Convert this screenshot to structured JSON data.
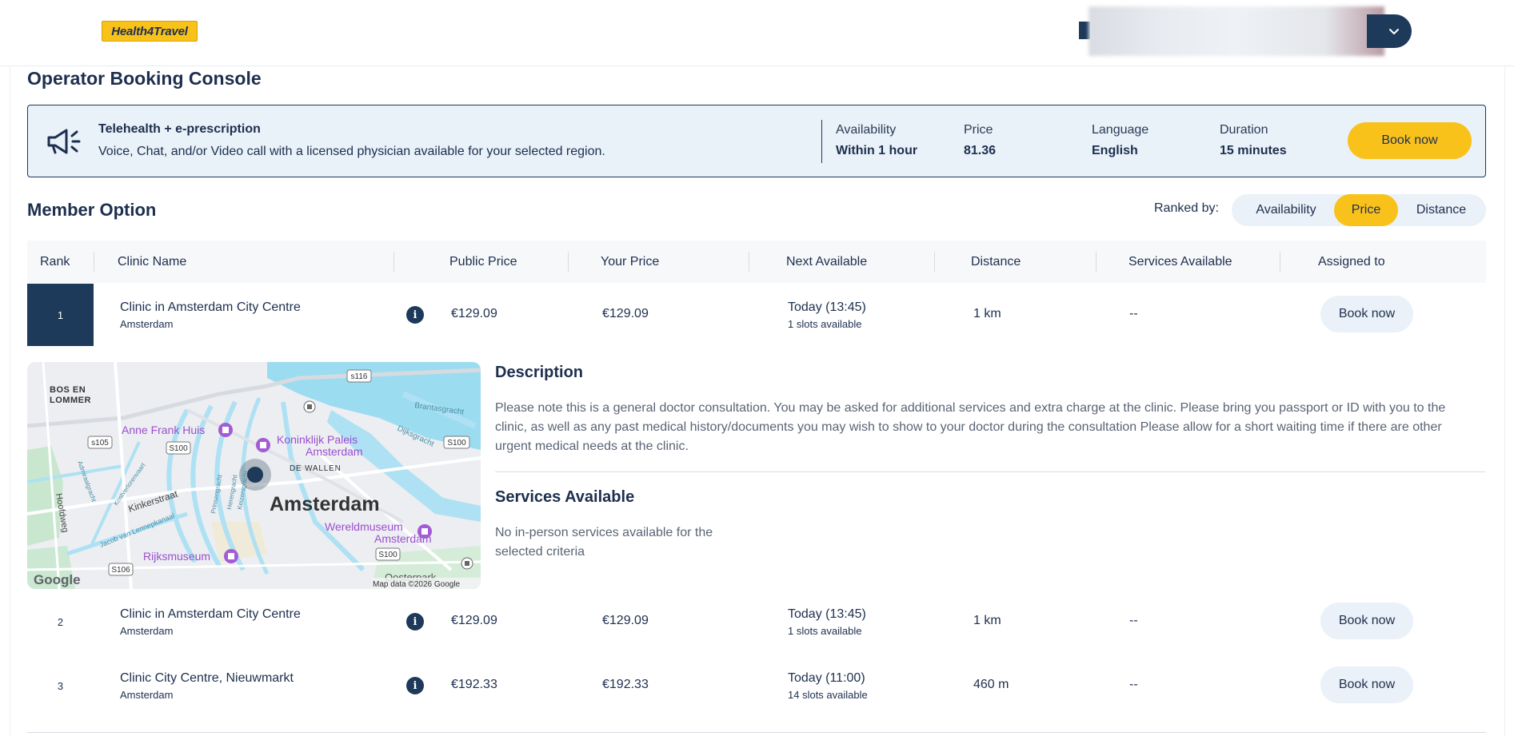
{
  "header": {
    "logo_text": "Health4Travel"
  },
  "page_title": "Operator Booking Console",
  "banner": {
    "title": "Telehealth + e-prescription",
    "description": "Voice, Chat, and/or Video call with a licensed physician available for your selected region.",
    "stats": [
      {
        "label": "Availability",
        "value": "Within 1 hour"
      },
      {
        "label": "Price",
        "value": "81.36"
      },
      {
        "label": "Language",
        "value": "English"
      },
      {
        "label": "Duration",
        "value": "15 minutes"
      }
    ],
    "book_label": "Book now"
  },
  "member_option": {
    "title": "Member Option",
    "ranked_by_label": "Ranked by:",
    "ranking_options": [
      "Availability",
      "Price",
      "Distance"
    ],
    "ranking_selected": "Price"
  },
  "table": {
    "columns": [
      "Rank",
      "Clinic Name",
      "Public Price",
      "Your Price",
      "Next Available",
      "Distance",
      "Services Available",
      "Assigned to"
    ],
    "rows": [
      {
        "rank": "1",
        "name": "Clinic in Amsterdam City Centre",
        "city": "Amsterdam",
        "public_price": "€129.09",
        "your_price": "€129.09",
        "next_available": "Today (13:45)",
        "slots": "1 slots available",
        "distance": "1 km",
        "services": "--",
        "action": "Book now"
      },
      {
        "rank": "2",
        "name": "Clinic in Amsterdam City Centre",
        "city": "Amsterdam",
        "public_price": "€129.09",
        "your_price": "€129.09",
        "next_available": "Today (13:45)",
        "slots": "1 slots available",
        "distance": "1 km",
        "services": "--",
        "action": "Book now"
      },
      {
        "rank": "3",
        "name": "Clinic City Centre, Nieuwmarkt",
        "city": "Amsterdam",
        "public_price": "€192.33",
        "your_price": "€192.33",
        "next_available": "Today (11:00)",
        "slots": "14 slots available",
        "distance": "460 m",
        "services": "--",
        "action": "Book now"
      }
    ]
  },
  "details": {
    "description_title": "Description",
    "description_text": "Please note this is a general doctor consultation. You may be asked for additional services and extra charge at the clinic. Please bring you passport or ID with you to the clinic, as well as any past medical history/documents you may wish to show to your doctor during the consultation Please allow for a short waiting time if there are other urgent medical needs at the clinic.",
    "services_title": "Services Available",
    "services_text": "No in-person services available for the selected criteria"
  },
  "map": {
    "city_label": "Amsterdam",
    "district_label": "BOS EN LOMMER",
    "de_wallen": "DE WALLEN",
    "poi": [
      "Anne Frank Huis",
      "Koninklijk Paleis Amsterdam",
      "Wereldmuseum Amsterdam",
      "Rijksmuseum",
      "Oosterpark"
    ],
    "road_badges": [
      "s116",
      "s105",
      "S100",
      "S100",
      "S100",
      "S106"
    ],
    "streets": [
      "Kinkerstraat",
      "Hoofdweg",
      "Jacob van Lennepkanaal",
      "Brantasgracht",
      "Dijksgracht",
      "Admiraalgracht",
      "Prinsengracht",
      "Herengracht",
      "Keizersgracht",
      "Kostverlorenvaart"
    ],
    "google_label": "Google",
    "attribution": "Map data ©2026 Google"
  },
  "colors": {
    "navy": "#1d3a5a",
    "accent_yellow": "#f9c21b",
    "banner_bg": "#e9f1f9",
    "chip_bg": "#ebf1f8"
  }
}
